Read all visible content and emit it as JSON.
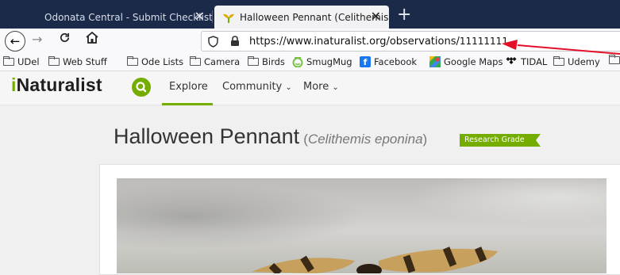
{
  "browser": {
    "tabs": [
      {
        "title": "Odonata Central - Submit Checklist"
      },
      {
        "title": "Halloween Pennant (Celithemis"
      }
    ],
    "url": {
      "host": "https://www.inaturalist.org/observations/",
      "path": "11111111"
    }
  },
  "bookmarks": [
    {
      "label": "UDel",
      "icon": "folder-icon"
    },
    {
      "label": "Web Stuff",
      "icon": "folder-icon"
    },
    {
      "label": "Ode Lists",
      "icon": "folder-icon"
    },
    {
      "label": "Camera",
      "icon": "folder-icon"
    },
    {
      "label": "Birds",
      "icon": "folder-icon"
    },
    {
      "label": "SmugMug",
      "icon": "smugmug-icon"
    },
    {
      "label": "Facebook",
      "icon": "facebook-icon"
    },
    {
      "label": "Google Maps",
      "icon": "google-maps-icon"
    },
    {
      "label": "TIDAL",
      "icon": "tidal-icon"
    },
    {
      "label": "Udemy",
      "icon": "folder-icon"
    }
  ],
  "site": {
    "logo_i": "i",
    "logo_rest": "Naturalist",
    "nav": {
      "explore": "Explore",
      "community": "Community",
      "more": "More"
    },
    "accent": "#74ac00"
  },
  "observation": {
    "common_name": "Halloween Pennant",
    "scientific_name": "Celithemis eponina",
    "paren_open": "(",
    "paren_close": ")",
    "quality_grade": "Research Grade"
  },
  "annotation": {
    "color": "#e4102a"
  }
}
